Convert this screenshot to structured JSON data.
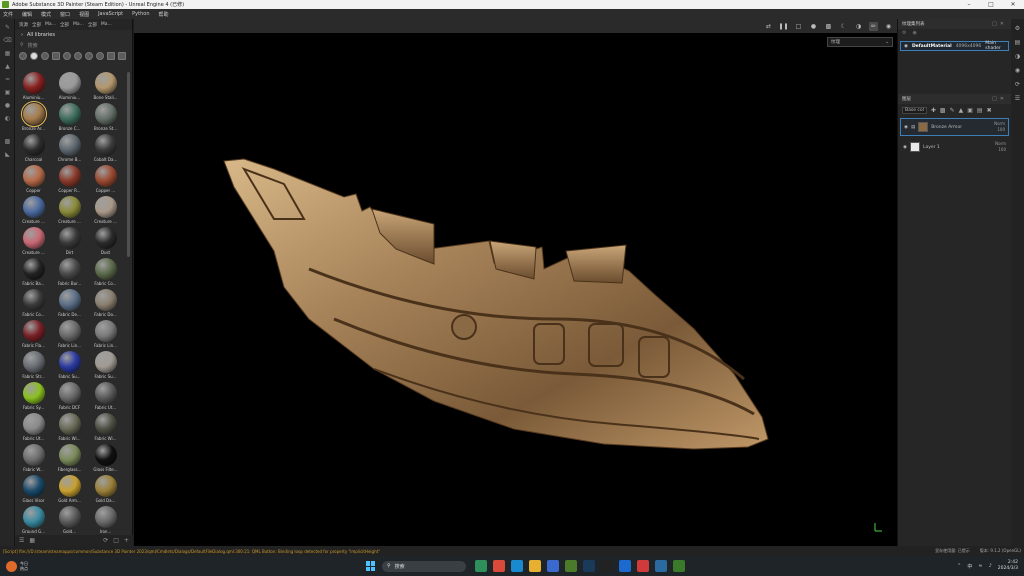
{
  "window": {
    "title": "Adobe Substance 3D Painter (Steam Edition) - Unreal Engine 4 (已修)",
    "minimize_icon": "minimize-icon",
    "maximize_icon": "maximize-icon",
    "close_icon": "close-icon"
  },
  "menu": [
    "文件",
    "编辑",
    "模式",
    "窗口",
    "视图",
    "JavaScript",
    "Python",
    "帮助"
  ],
  "tools": [
    "paint-brush-icon",
    "eraser-icon",
    "projection-icon",
    "geometry-mask-icon",
    "smudge-icon",
    "clone-icon",
    "color-picker-icon",
    "material-picker-icon",
    "bake-icon",
    "polygon-fill-icon"
  ],
  "shelf": {
    "tabs": [
      "资源",
      "全部",
      "Ma...",
      "全部",
      "Ma...",
      "全部",
      "Ma..."
    ],
    "library": "All libraries",
    "search_placeholder": "搜索",
    "materials": [
      {
        "label": "Aluminiu...",
        "color": "#8a2020"
      },
      {
        "label": "Aluminiu...",
        "color": "#9a9a9a"
      },
      {
        "label": "Bone Stali...",
        "color": "#b3976d"
      },
      {
        "label": "Bronze Ar...",
        "color": "#a57c4c"
      },
      {
        "label": "Bronze C...",
        "color": "#3e6e5e"
      },
      {
        "label": "Bronze St...",
        "color": "#647068"
      },
      {
        "label": "Charcoal",
        "color": "#2d2d2d"
      },
      {
        "label": "Chrome B...",
        "color": "#5e6870"
      },
      {
        "label": "Cobalt Da...",
        "color": "#3a3a3a"
      },
      {
        "label": "Copper",
        "color": "#b66a48"
      },
      {
        "label": "Copper R...",
        "color": "#8a3a2a"
      },
      {
        "label": "Copper ...",
        "color": "#9a4a30"
      },
      {
        "label": "Creature ...",
        "color": "#4b6aa0"
      },
      {
        "label": "Creature ...",
        "color": "#8a8a3a"
      },
      {
        "label": "Creature ...",
        "color": "#a89888"
      },
      {
        "label": "Creature ...",
        "color": "#c86874"
      },
      {
        "label": "Dirt",
        "color": "#3a3a3a"
      },
      {
        "label": "Dust",
        "color": "#2a2a2a"
      },
      {
        "label": "Fabric Ba...",
        "color": "#232323"
      },
      {
        "label": "Fabric Bur...",
        "color": "#4a4a4a"
      },
      {
        "label": "Fabric Co...",
        "color": "#5b6a4a"
      },
      {
        "label": "Fabric Co...",
        "color": "#3a3a3a"
      },
      {
        "label": "Fabric De...",
        "color": "#5a6e86"
      },
      {
        "label": "Fabric Do...",
        "color": "#8a8070"
      },
      {
        "label": "Fabric Fla...",
        "color": "#7a2026"
      },
      {
        "label": "Fabric Lin...",
        "color": "#6a6a6a"
      },
      {
        "label": "Fabric Lin...",
        "color": "#7a7a7a"
      },
      {
        "label": "Fabric Str...",
        "color": "#6a6e74"
      },
      {
        "label": "Fabric Su...",
        "color": "#2a3aa0"
      },
      {
        "label": "Fabric Su...",
        "color": "#a09a92"
      },
      {
        "label": "Fabric Sy...",
        "color": "#8ac020"
      },
      {
        "label": "Fabric DCF",
        "color": "#6a6a6a"
      },
      {
        "label": "Fabric Ut...",
        "color": "#5a5a5a"
      },
      {
        "label": "Fabric Ut...",
        "color": "#8a8a8a"
      },
      {
        "label": "Fabric Wi...",
        "color": "#6a6a58"
      },
      {
        "label": "Fabric Wi...",
        "color": "#4e5044"
      },
      {
        "label": "Fabric W...",
        "color": "#6e6e6e"
      },
      {
        "label": "Fiberglass...",
        "color": "#7a8a5a"
      },
      {
        "label": "Glass Filte...",
        "color": "#111111"
      },
      {
        "label": "Glass Visor",
        "color": "#1a4a6a"
      },
      {
        "label": "Gold Arm...",
        "color": "#c8a030"
      },
      {
        "label": "Gold Da...",
        "color": "#9a8038"
      },
      {
        "label": "Ground G...",
        "color": "#3a8aa0"
      },
      {
        "label": "Gold...",
        "color": "#5a5a5a"
      },
      {
        "label": "Iron...",
        "color": "#6a6a6a"
      }
    ],
    "bottom_icons": [
      "list-view-icon",
      "grid-view-icon",
      "refresh-icon",
      "new-window-icon",
      "add-icon"
    ]
  },
  "viewport": {
    "toolbar_icons": [
      "symmetry-icon",
      "pause-icon",
      "viewport-icon",
      "sphere-icon",
      "camera-icon",
      "environment-icon",
      "render-icon",
      "paint-mode-icon",
      "screenshot-icon"
    ],
    "view_mode": "纹理"
  },
  "texture_set_panel": {
    "title": "纹理集列表",
    "material_name": "DefaultMaterial",
    "resolution": "4096x4096",
    "shader": "Main shader"
  },
  "layers_panel": {
    "title": "图层",
    "blend_channel": "Base col",
    "layers": [
      {
        "name": "Bronze Armor",
        "blend": "Norm",
        "opacity": "100",
        "selected": true
      },
      {
        "name": "Layer 1",
        "blend": "Norm",
        "opacity": "100",
        "selected": false
      }
    ]
  },
  "right_strip": [
    "settings-icon",
    "shelf-icon",
    "display-icon",
    "color-icon",
    "history-icon",
    "log-icon"
  ],
  "status": {
    "log": "[Script] file:///D:/steam/steamapps/common/Substance 3D Painter 2023/qml/Cmdlets/Dialogs/DefaultFileDialog.qml:300:21: QML Button: Binding loop detected for property \"implicitHeight\"",
    "cache": "显存使用量: 已提示",
    "version": "版本: 9.1.2 (OpenGL)"
  },
  "taskbar": {
    "weather_temp": "今日",
    "weather_desc": "热点",
    "search_placeholder": "搜索",
    "apps": [
      {
        "name": "file-explorer-icon",
        "color": "#2f8f5a"
      },
      {
        "name": "chrome-icon",
        "color": "#d94a3a"
      },
      {
        "name": "edge-icon",
        "color": "#1a8ad0"
      },
      {
        "name": "folder-icon",
        "color": "#e8b030"
      },
      {
        "name": "store-icon",
        "color": "#3a6ad0"
      },
      {
        "name": "photoshop-icon",
        "color": "#4a7a2a"
      },
      {
        "name": "steam-icon",
        "color": "#1a3a5a"
      },
      {
        "name": "unreal-icon",
        "color": "#222222"
      },
      {
        "name": "media-icon",
        "color": "#1a6ad0"
      },
      {
        "name": "paint-icon",
        "color": "#d03a3a"
      },
      {
        "name": "gallery-icon",
        "color": "#2a6aa0"
      },
      {
        "name": "painter-icon",
        "color": "#3a7a2a"
      }
    ],
    "tray_lang": "中",
    "time": "2:42",
    "date": "2024/3/3"
  }
}
